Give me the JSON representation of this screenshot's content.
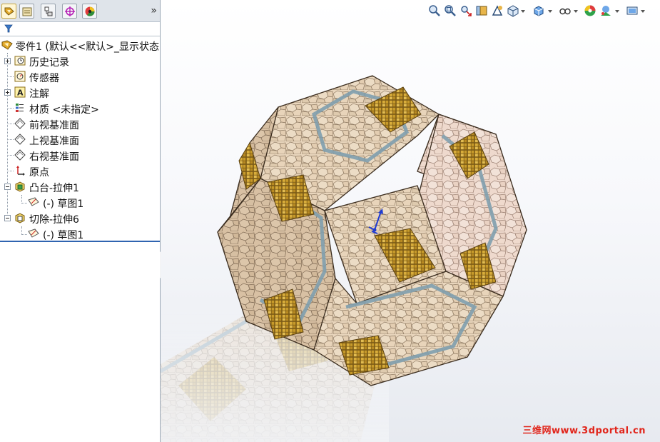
{
  "feature_tree": {
    "tabs": [
      {
        "name": "feature-manager-tab",
        "icon": "feature-tree-icon"
      },
      {
        "name": "property-manager-tab",
        "icon": "property-icon"
      },
      {
        "name": "configuration-manager-tab",
        "icon": "configuration-icon"
      },
      {
        "name": "dimxpert-tab",
        "icon": "dimxpert-icon"
      },
      {
        "name": "display-manager-tab",
        "icon": "display-manager-icon"
      }
    ],
    "more_label": "»",
    "root_label": "零件1  (默认<<默认>_显示状态",
    "items": [
      {
        "label": "历史记录",
        "icon": "history-icon"
      },
      {
        "label": "传感器",
        "icon": "sensor-icon"
      },
      {
        "label": "注解",
        "icon": "annotation-icon"
      },
      {
        "label": "材质 <未指定>",
        "icon": "material-icon"
      },
      {
        "label": "前视基准面",
        "icon": "plane-icon"
      },
      {
        "label": "上视基准面",
        "icon": "plane-icon"
      },
      {
        "label": "右视基准面",
        "icon": "plane-icon"
      },
      {
        "label": "原点",
        "icon": "origin-icon"
      },
      {
        "label": "凸台-拉伸1",
        "icon": "extrude-boss-icon"
      },
      {
        "label": "(-) 草图1",
        "icon": "sketch-icon"
      },
      {
        "label": "切除-拉伸6",
        "icon": "extrude-cut-icon"
      },
      {
        "label": "(-) 草图1",
        "icon": "sketch-icon"
      }
    ]
  },
  "heads_up_toolbar": {
    "icons": [
      "zoom-to-fit-icon",
      "zoom-to-area-icon",
      "previous-view-icon",
      "section-view-icon",
      "dynamic-annotation-icon",
      "view-orientation-icon",
      "display-style-icon",
      "hide-show-icon",
      "edit-appearance-icon",
      "apply-scene-icon",
      "view-settings-icon"
    ]
  },
  "watermark": "三维网www.3dportal.cn",
  "colors": {
    "accent": "#2f64b0",
    "tile_tan": "#e6d2b8",
    "tile_gold": "#c9a227",
    "grout_blue": "#7f9fae",
    "watermark": "#e1251b"
  }
}
